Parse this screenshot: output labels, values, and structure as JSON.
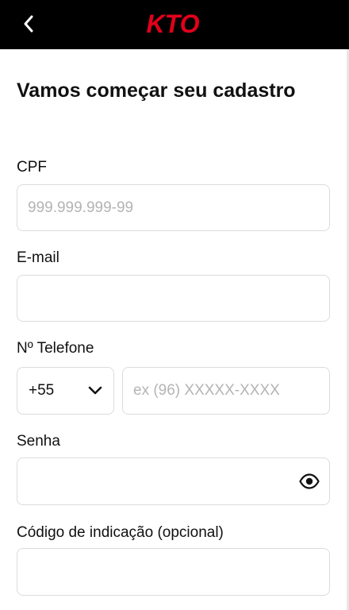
{
  "header": {
    "brand": "KTO",
    "brand_color": "#e3001b",
    "back_icon": "chevron-left-icon"
  },
  "form": {
    "title": "Vamos começar seu cadastro",
    "cpf": {
      "label": "CPF",
      "placeholder": "999.999.999-99",
      "value": ""
    },
    "email": {
      "label": "E-mail",
      "placeholder": "",
      "value": ""
    },
    "phone": {
      "label": "Nº Telefone",
      "country_code": "+55",
      "placeholder": "ex (96) XXXXX-XXXX",
      "value": ""
    },
    "password": {
      "label": "Senha",
      "placeholder": "",
      "value": "",
      "toggle_icon": "eye-icon"
    },
    "referral": {
      "label": "Código de indicação (opcional)",
      "placeholder": "",
      "value": ""
    }
  }
}
